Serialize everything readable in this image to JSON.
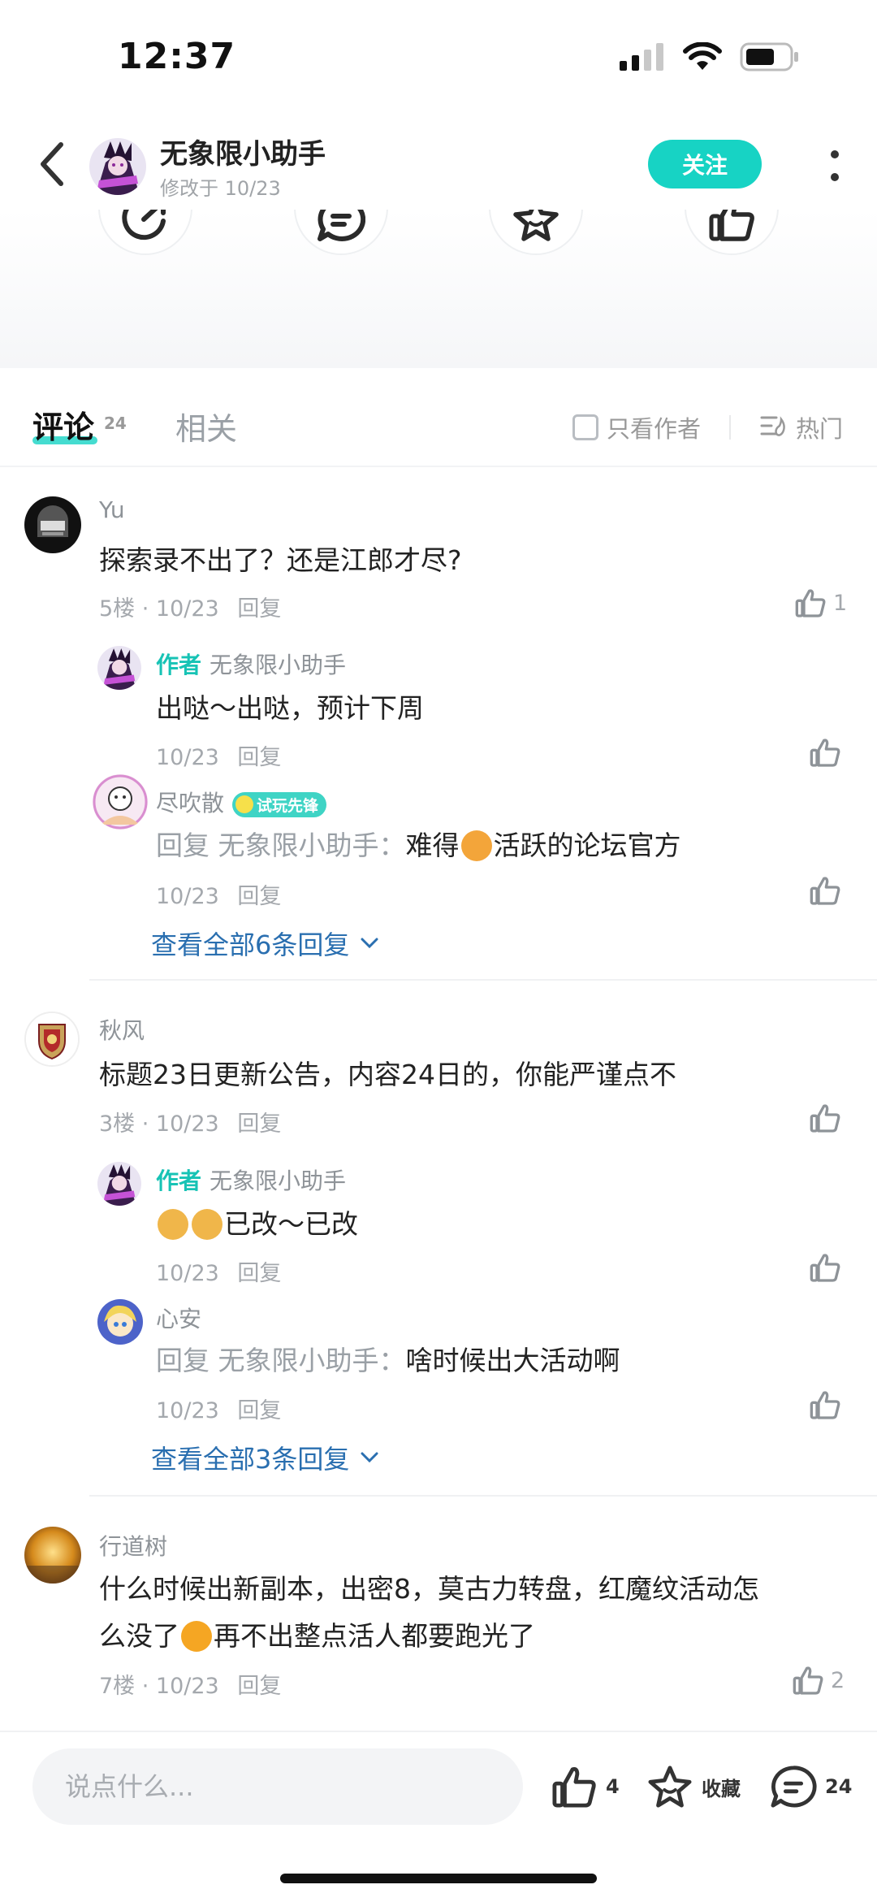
{
  "status_bar": {
    "time": "12:37"
  },
  "header": {
    "author_name": "无象限小助手",
    "modified": "修改于 10/23",
    "follow_label": "关注"
  },
  "actions": {
    "icons": [
      "share-icon",
      "comment-icon",
      "star-icon",
      "like-icon"
    ]
  },
  "tabs": {
    "comments_label": "评论",
    "comments_count": "24",
    "related_label": "相关",
    "only_author_label": "只看作者",
    "sort_label": "热门"
  },
  "comments": [
    {
      "name": "Yu",
      "text": "探索录不出了？还是江郎才尽?",
      "meta": "5楼 · 10/23",
      "reply_label": "回复",
      "likes": "1",
      "replies": [
        {
          "is_author": true,
          "author_tag": "作者",
          "name": "无象限小助手",
          "text": "出哒～出哒，预计下周",
          "meta": "10/23",
          "reply_label": "回复"
        },
        {
          "is_author": false,
          "name": "尽吹散",
          "badge": "试玩先锋",
          "reply_prefix": "回复 无象限小助手：",
          "text_before": "难得",
          "text_after": "活跃的论坛官方",
          "meta": "10/23",
          "reply_label": "回复"
        }
      ],
      "view_all": "查看全部6条回复"
    },
    {
      "name": "秋风",
      "text": "标题23日更新公告，内容24日的，你能严谨点不",
      "meta": "3楼 · 10/23",
      "reply_label": "回复",
      "likes": "",
      "replies": [
        {
          "is_author": true,
          "author_tag": "作者",
          "name": "无象限小助手",
          "text": "已改～已改",
          "meta": "10/23",
          "reply_label": "回复"
        },
        {
          "is_author": false,
          "name": "心安",
          "reply_prefix": "回复 无象限小助手：",
          "text": "啥时候出大活动啊",
          "meta": "10/23",
          "reply_label": "回复"
        }
      ],
      "view_all": "查看全部3条回复"
    },
    {
      "name": "行道树",
      "text_line1": "什么时候出新副本，出密8，莫古力转盘，红魔纹活动怎",
      "text_line2_before": "么没了",
      "text_line2_after": "再不出整点活人都要跑光了",
      "meta": "7楼 · 10/23",
      "reply_label": "回复",
      "likes": "2"
    }
  ],
  "bottom_bar": {
    "input_placeholder": "说点什么...",
    "like_count": "4",
    "favorite_label": "收藏",
    "comment_count": "24"
  },
  "colors": {
    "accent": "#17d3c4",
    "link": "#2a6fb0"
  }
}
